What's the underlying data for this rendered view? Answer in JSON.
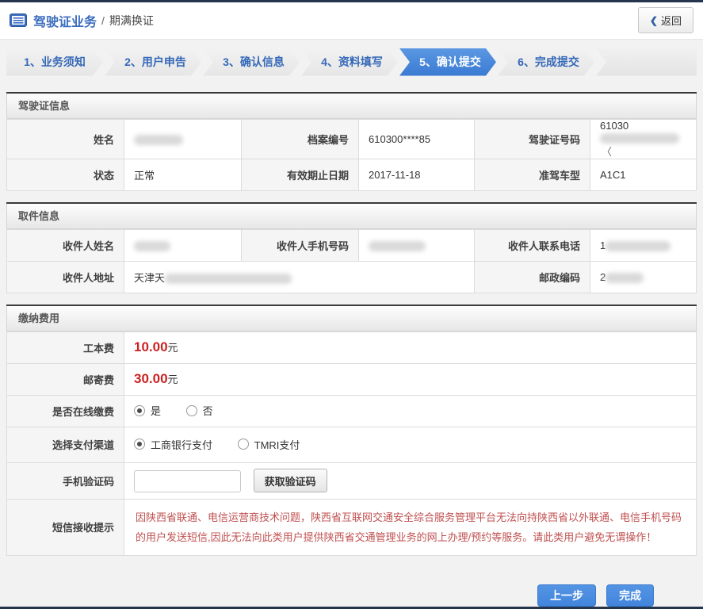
{
  "header": {
    "breadcrumb_section": "驾驶证业务",
    "breadcrumb_separator": "/",
    "breadcrumb_current": "期满换证",
    "back_arrow": "❮",
    "back_label": "返回"
  },
  "wizard": {
    "steps": [
      {
        "label": "1、业务须知",
        "active": false
      },
      {
        "label": "2、用户申告",
        "active": false
      },
      {
        "label": "3、确认信息",
        "active": false
      },
      {
        "label": "4、资料填写",
        "active": false
      },
      {
        "label": "5、确认提交",
        "active": true
      },
      {
        "label": "6、完成提交",
        "active": false
      }
    ]
  },
  "license_section": {
    "title": "驾驶证信息",
    "name_label": "姓名",
    "name_value": "",
    "file_no_label": "档案编号",
    "file_no_value": "610300****85",
    "license_no_label": "驾驶证号码",
    "license_no_prefix": "61030",
    "license_no_suffix": "〈",
    "status_label": "状态",
    "status_value": "正常",
    "expiry_label": "有效期止日期",
    "expiry_value": "2017-11-18",
    "vehicle_class_label": "准驾车型",
    "vehicle_class_value": "A1C1"
  },
  "pickup_section": {
    "title": "取件信息",
    "recipient_name_label": "收件人姓名",
    "recipient_name_value": "",
    "recipient_mobile_label": "收件人手机号码",
    "recipient_mobile_value": "",
    "recipient_phone_label": "收件人联系电话",
    "recipient_phone_prefix": "1",
    "recipient_address_label": "收件人地址",
    "recipient_address_prefix": "天津天",
    "postal_code_label": "邮政编码",
    "postal_code_prefix": "2"
  },
  "payment_section": {
    "title": "缴纳费用",
    "production_fee_label": "工本费",
    "production_fee_value": "10.00",
    "postage_fee_label": "邮寄费",
    "postage_fee_value": "30.00",
    "fee_unit": "元",
    "online_pay_label": "是否在线缴费",
    "online_pay_options": [
      {
        "label": "是",
        "selected": true
      },
      {
        "label": "否",
        "selected": false
      }
    ],
    "channel_label": "选择支付渠道",
    "channel_options": [
      {
        "label": "工商银行支付",
        "selected": true
      },
      {
        "label": "TMRI支付",
        "selected": false
      }
    ],
    "sms_code_label": "手机验证码",
    "sms_code_value": "",
    "get_code_button": "获取验证码",
    "sms_notice_label": "短信接收提示",
    "sms_notice_text": "因陕西省联通、电信运营商技术问题，陕西省互联网交通安全综合服务管理平台无法向持陕西省以外联通、电信手机号码的用户发送短信,因此无法向此类用户提供陕西省交通管理业务的网上办理/预约等服务。请此类用户避免无谓操作！"
  },
  "footer": {
    "prev_button": "上一步",
    "finish_button": "完成"
  },
  "colors": {
    "accent_blue": "#3a7ad3",
    "dark_bar": "#25354e",
    "fee_red": "#cc2222",
    "notice_red": "#c05050",
    "link_blue": "#3a6cbf"
  }
}
